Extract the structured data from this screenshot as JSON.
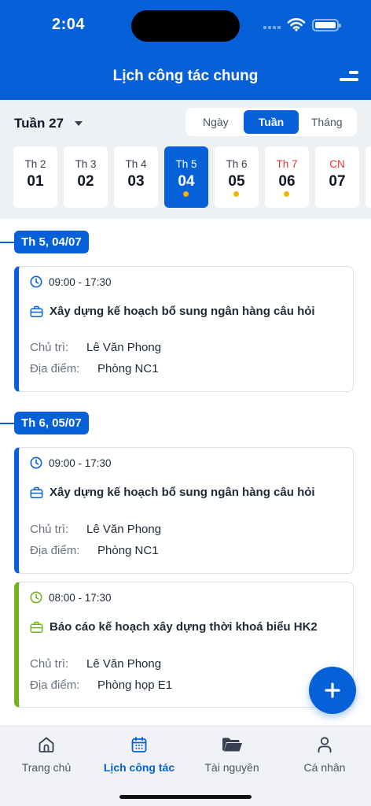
{
  "status_bar": {
    "time": "2:04"
  },
  "header": {
    "title": "Lịch công tác chung",
    "menu_icon": "menu-icon"
  },
  "filter": {
    "week_label": "Tuần 27",
    "view_modes": [
      {
        "label": "Ngày",
        "active": false
      },
      {
        "label": "Tuần",
        "active": true
      },
      {
        "label": "Tháng",
        "active": false
      }
    ]
  },
  "days": [
    {
      "name": "Th 2",
      "date": "01",
      "dot": false,
      "selected": false,
      "weekend": false
    },
    {
      "name": "Th 3",
      "date": "02",
      "dot": false,
      "selected": false,
      "weekend": false
    },
    {
      "name": "Th 4",
      "date": "03",
      "dot": false,
      "selected": false,
      "weekend": false
    },
    {
      "name": "Th 5",
      "date": "04",
      "dot": true,
      "selected": true,
      "weekend": false
    },
    {
      "name": "Th 6",
      "date": "05",
      "dot": true,
      "selected": false,
      "weekend": false
    },
    {
      "name": "Th 7",
      "date": "06",
      "dot": true,
      "selected": false,
      "weekend": true
    },
    {
      "name": "CN",
      "date": "07",
      "dot": false,
      "selected": false,
      "weekend": true
    }
  ],
  "groups": [
    {
      "date_label": "Th 5, 04/07",
      "events": [
        {
          "time": "09:00 - 17:30",
          "title": "Xây dựng kế hoạch bổ sung ngân hàng câu hỏi",
          "host_label": "Chủ trì:",
          "host": "Lê Văn Phong",
          "location_label": "Địa điểm:",
          "location": "Phòng NC1",
          "color": "#0661d8"
        }
      ]
    },
    {
      "date_label": "Th 6, 05/07",
      "events": [
        {
          "time": "09:00 - 17:30",
          "title": "Xây dựng kế hoạch bổ sung ngân hàng câu hỏi",
          "host_label": "Chủ trì:",
          "host": "Lê Văn Phong",
          "location_label": "Địa điểm:",
          "location": "Phòng NC1",
          "color": "#0661d8"
        },
        {
          "time": "08:00 - 17:30",
          "title": "Báo cáo kế hoạch xây dựng thời khoá biểu HK2",
          "host_label": "Chủ trì:",
          "host": "Lê Văn Phong",
          "location_label": "Địa điểm:",
          "location": "Phòng họp E1",
          "color": "#70b422"
        }
      ]
    }
  ],
  "fab": {
    "icon": "plus-icon"
  },
  "bottom_nav": [
    {
      "label": "Trang chủ",
      "icon": "home-icon",
      "active": false
    },
    {
      "label": "Lịch công tác",
      "icon": "calendar-icon",
      "active": true
    },
    {
      "label": "Tài nguyên",
      "icon": "folder-icon",
      "active": false
    },
    {
      "label": "Cá nhân",
      "icon": "user-icon",
      "active": false
    }
  ],
  "colors": {
    "primary": "#0661d8",
    "accent_green": "#70b422",
    "dot": "#f5b301",
    "weekend": "#e23636"
  }
}
